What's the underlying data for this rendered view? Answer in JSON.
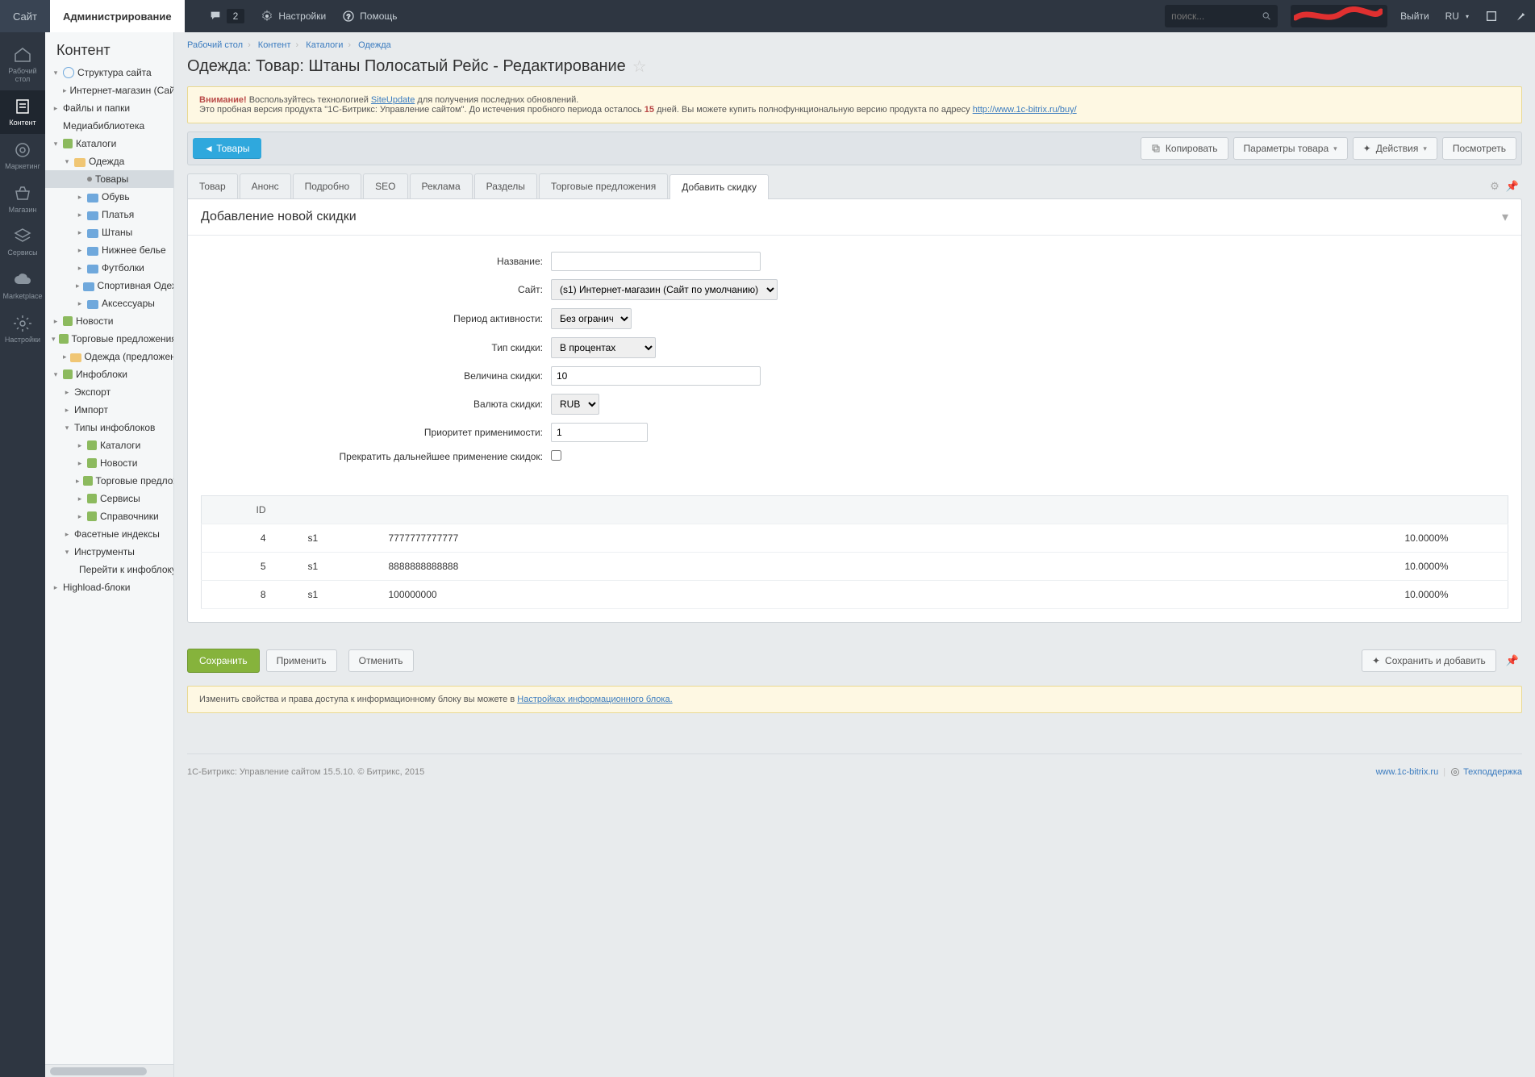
{
  "topbar": {
    "tab_site": "Сайт",
    "tab_admin": "Администрирование",
    "notif_count": "2",
    "settings": "Настройки",
    "help": "Помощь",
    "search_placeholder": "поиск...",
    "logout": "Выйти",
    "lang": "RU"
  },
  "rail": {
    "desktop": "Рабочий стол",
    "content": "Контент",
    "marketing": "Маркетинг",
    "shop": "Магазин",
    "services": "Сервисы",
    "marketplace": "Marketplace",
    "settings": "Настройки"
  },
  "sidebar": {
    "title": "Контент",
    "items": {
      "structure": "Структура сайта",
      "eshop": "Интернет-магазин (Сайт по",
      "files": "Файлы и папки",
      "media": "Медиабиблиотека",
      "catalogs": "Каталоги",
      "clothes": "Одежда",
      "goods": "Товары",
      "shoes": "Обувь",
      "dresses": "Платья",
      "pants": "Штаны",
      "underwear": "Нижнее белье",
      "tshirts": "Футболки",
      "sportwear": "Спортивная Одежд",
      "accessories": "Аксессуары",
      "news": "Новости",
      "trade_offers": "Торговые предложения",
      "clothes_offers": "Одежда (предложения",
      "infoblocks": "Инфоблоки",
      "export": "Экспорт",
      "import": "Импорт",
      "ib_types": "Типы инфоблоков",
      "ib_catalogs": "Каталоги",
      "ib_news": "Новости",
      "ib_trade": "Торговые предложе",
      "ib_services": "Сервисы",
      "ib_refs": "Справочники",
      "facet": "Фасетные индексы",
      "tools": "Инструменты",
      "goto_ib": "Перейти к инфоблоку /",
      "highload": "Highload-блоки"
    }
  },
  "breadcrumb": {
    "b1": "Рабочий стол",
    "b2": "Контент",
    "b3": "Каталоги",
    "b4": "Одежда"
  },
  "page": {
    "title": "Одежда: Товар: Штаны Полосатый Рейс - Редактирование"
  },
  "notice": {
    "warn": "Внимание!",
    "t1": "Воспользуйтесь технологией",
    "link1": "SiteUpdate",
    "t2": "для получения последних обновлений.",
    "line2a": "Это пробная версия продукта \"1С-Битрикс: Управление сайтом\". До истечения пробного периода осталось",
    "days": "15",
    "line2b": "дней. Вы можете купить полнофункциональную версию продукта по адресу",
    "buy_url": "http://www.1c-bitrix.ru/buy/"
  },
  "toolbar": {
    "goods": "Товары",
    "copy": "Копировать",
    "params": "Параметры товара",
    "actions": "Действия",
    "view": "Посмотреть"
  },
  "tabs": {
    "t1": "Товар",
    "t2": "Анонс",
    "t3": "Подробно",
    "t4": "SEO",
    "t5": "Реклама",
    "t6": "Разделы",
    "t7": "Торговые предложения",
    "t8": "Добавить скидку"
  },
  "panel": {
    "title": "Добавление новой скидки"
  },
  "form": {
    "name_label": "Название:",
    "name_value": "",
    "site_label": "Сайт:",
    "site_value": "(s1) Интернет-магазин (Сайт по умолчанию)",
    "period_label": "Период активности:",
    "period_value": "Без ограничений",
    "type_label": "Тип скидки:",
    "type_value": "В процентах",
    "amount_label": "Величина скидки:",
    "amount_value": "10",
    "currency_label": "Валюта скидки:",
    "currency_value": "RUB",
    "priority_label": "Приоритет применимости:",
    "priority_value": "1",
    "stop_label": "Прекратить дальнейшее применение скидок:"
  },
  "table": {
    "h_id": "ID",
    "rows": [
      {
        "id": "4",
        "site": "s1",
        "name": "7777777777777",
        "pct": "10.0000%"
      },
      {
        "id": "5",
        "site": "s1",
        "name": "8888888888888",
        "pct": "10.0000%"
      },
      {
        "id": "8",
        "site": "s1",
        "name": "100000000",
        "pct": "10.0000%"
      }
    ]
  },
  "actions": {
    "save": "Сохранить",
    "apply": "Применить",
    "cancel": "Отменить",
    "save_add": "Сохранить и добавить"
  },
  "hint": {
    "t1": "Изменить свойства и права доступа к информационному блоку вы можете в",
    "link": "Настройках информационного блока."
  },
  "footer": {
    "left": "1С-Битрикс: Управление сайтом 15.5.10. © Битрикс, 2015",
    "site": "www.1c-bitrix.ru",
    "support": "Техподдержка"
  }
}
